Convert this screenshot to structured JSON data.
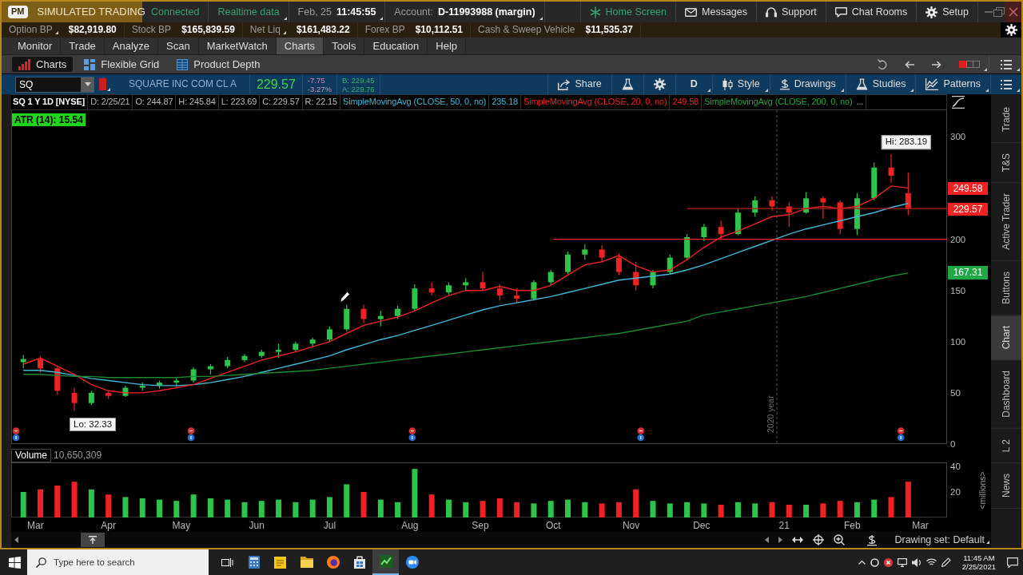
{
  "title_bar": {
    "badge": "PM",
    "mode": "SIMULATED TRADING",
    "status": [
      {
        "label": "Connected",
        "menu": false
      },
      {
        "label": "Realtime data",
        "menu": true
      }
    ],
    "clock": {
      "date": "Feb, 25",
      "time": "11:45:55",
      "menu": true
    },
    "account": {
      "label": "Account:",
      "value": "D-11993988 (margin)",
      "menu": true
    },
    "links": [
      {
        "kind": "home",
        "label": "Home Screen"
      },
      {
        "kind": "mail",
        "label": "Messages"
      },
      {
        "kind": "headset",
        "label": "Support"
      },
      {
        "kind": "chat",
        "label": "Chat Rooms"
      },
      {
        "kind": "gear",
        "label": "Setup"
      }
    ]
  },
  "account_bar": [
    {
      "label": "Option BP",
      "value": "$82,919.80",
      "menu": true
    },
    {
      "label": "Stock BP",
      "value": "$165,839.59",
      "menu": false
    },
    {
      "label": "Net Liq",
      "value": "$161,483.22",
      "menu": true
    },
    {
      "label": "Forex BP",
      "value": "$10,112.51",
      "menu": false
    },
    {
      "label": "Cash & Sweep Vehicle",
      "value": "$11,535.37",
      "menu": false
    }
  ],
  "main_tabs": [
    {
      "label": "Monitor",
      "selected": false
    },
    {
      "label": "Trade",
      "selected": false
    },
    {
      "label": "Analyze",
      "selected": false
    },
    {
      "label": "Scan",
      "selected": false
    },
    {
      "label": "MarketWatch",
      "selected": false
    },
    {
      "label": "Charts",
      "selected": true
    },
    {
      "label": "Tools",
      "selected": false
    },
    {
      "label": "Education",
      "selected": false
    },
    {
      "label": "Help",
      "selected": false
    }
  ],
  "sub_tabs": [
    {
      "kind": "charts",
      "label": "Charts",
      "selected": true
    },
    {
      "kind": "grid",
      "label": "Flexible Grid",
      "selected": false
    },
    {
      "kind": "depth",
      "label": "Product Depth",
      "selected": false
    }
  ],
  "quote_bar": {
    "symbol": "SQ",
    "description": "SQUARE INC COM CL A",
    "last": "229.57",
    "change": "-7.75",
    "change_percent": "-3.27%",
    "bid": "B: 229.45",
    "ask": "A: 229.76",
    "tools": [
      {
        "kind": "share",
        "label": "Share",
        "menu": false
      },
      {
        "kind": "flask",
        "menu": false
      },
      {
        "kind": "gear",
        "menu": false
      },
      {
        "kind": "aggregation",
        "label": "D",
        "menu": true
      },
      {
        "kind": "style",
        "label": "Style",
        "menu": true
      },
      {
        "kind": "drawings",
        "label": "Drawings",
        "menu": true
      },
      {
        "kind": "studies",
        "label": "Studies",
        "menu": true
      },
      {
        "kind": "patterns",
        "label": "Patterns",
        "menu": true
      },
      {
        "kind": "menu",
        "menu": true
      }
    ]
  },
  "chart_header": {
    "title": "SQ 1 Y 1D [NYSE]",
    "fields": [
      "D: 2/25/21",
      "O: 244.87",
      "H: 245.84",
      "L: 223.69",
      "C: 229.57",
      "R: 22.15"
    ],
    "studies": [
      {
        "label": "SimpleMovingAvg (CLOSE, 50, 0, no)",
        "value": "235.18",
        "color": "#3fb8d8"
      },
      {
        "label": "SimpleMovingAvg (CLOSE, 20, 0, no)",
        "value": "249.58",
        "color": "#ee2222"
      },
      {
        "label": "SimpleMovingAvg (CLOSE, 200, 0, no)",
        "color": "#22a63a"
      }
    ],
    "more": "..."
  },
  "price_pane": {
    "indicator": "ATR (14): 15.54",
    "axis_badges": [
      {
        "label": "249.58",
        "color": "#ee2222"
      },
      {
        "label": "229.57",
        "color": "#ee2222"
      },
      {
        "label": "167.31",
        "color": "#1fa845"
      }
    ],
    "chart_data": {
      "type": "candlestick",
      "x": [
        "2020-02-26",
        "2020-03-04",
        "2020-03-11",
        "2020-03-18",
        "2020-03-25",
        "2020-04-01",
        "2020-04-08",
        "2020-04-15",
        "2020-04-22",
        "2020-04-29",
        "2020-05-06",
        "2020-05-13",
        "2020-05-20",
        "2020-05-27",
        "2020-06-03",
        "2020-06-10",
        "2020-06-17",
        "2020-06-24",
        "2020-07-01",
        "2020-07-08",
        "2020-07-15",
        "2020-07-22",
        "2020-07-29",
        "2020-08-05",
        "2020-08-12",
        "2020-08-19",
        "2020-08-26",
        "2020-09-02",
        "2020-09-09",
        "2020-09-16",
        "2020-09-23",
        "2020-09-30",
        "2020-10-07",
        "2020-10-14",
        "2020-10-21",
        "2020-10-28",
        "2020-11-04",
        "2020-11-11",
        "2020-11-18",
        "2020-11-25",
        "2020-12-02",
        "2020-12-09",
        "2020-12-16",
        "2020-12-23",
        "2020-12-30",
        "2021-01-06",
        "2021-01-13",
        "2021-01-20",
        "2021-01-27",
        "2021-02-03",
        "2021-02-10",
        "2021-02-17",
        "2021-02-24"
      ],
      "ohlc": [
        [
          80,
          87,
          74,
          83
        ],
        [
          83,
          86,
          70,
          74
        ],
        [
          74,
          76,
          48,
          52
        ],
        [
          50,
          55,
          32.33,
          40
        ],
        [
          40,
          52,
          38,
          50
        ],
        [
          50,
          52,
          44,
          47
        ],
        [
          47,
          57,
          46,
          55
        ],
        [
          55,
          60,
          52,
          57
        ],
        [
          57,
          62,
          54,
          60
        ],
        [
          60,
          64,
          56,
          62
        ],
        [
          62,
          75,
          60,
          73
        ],
        [
          73,
          78,
          68,
          76
        ],
        [
          76,
          85,
          74,
          82
        ],
        [
          82,
          88,
          80,
          86
        ],
        [
          86,
          92,
          84,
          90
        ],
        [
          90,
          98,
          84,
          92
        ],
        [
          92,
          100,
          90,
          98
        ],
        [
          98,
          104,
          95,
          102
        ],
        [
          102,
          115,
          100,
          112
        ],
        [
          112,
          136,
          110,
          132
        ],
        [
          132,
          136,
          118,
          122
        ],
        [
          122,
          130,
          115,
          125
        ],
        [
          125,
          135,
          122,
          132
        ],
        [
          132,
          156,
          130,
          152
        ],
        [
          152,
          158,
          145,
          148
        ],
        [
          148,
          158,
          146,
          155
        ],
        [
          155,
          162,
          150,
          158
        ],
        [
          158,
          168,
          150,
          152
        ],
        [
          152,
          156,
          140,
          145
        ],
        [
          145,
          152,
          138,
          142
        ],
        [
          142,
          160,
          140,
          158
        ],
        [
          158,
          170,
          155,
          168
        ],
        [
          168,
          188,
          166,
          185
        ],
        [
          185,
          195,
          180,
          190
        ],
        [
          190,
          194,
          178,
          182
        ],
        [
          182,
          186,
          165,
          168
        ],
        [
          168,
          178,
          150,
          155
        ],
        [
          155,
          170,
          152,
          168
        ],
        [
          168,
          185,
          166,
          182
        ],
        [
          182,
          205,
          180,
          202
        ],
        [
          202,
          215,
          198,
          212
        ],
        [
          212,
          218,
          200,
          205
        ],
        [
          205,
          230,
          204,
          226
        ],
        [
          226,
          242,
          222,
          238
        ],
        [
          238,
          242,
          228,
          232
        ],
        [
          232,
          236,
          212,
          226
        ],
        [
          226,
          246,
          225,
          240
        ],
        [
          240,
          242,
          220,
          236
        ],
        [
          236,
          238,
          205,
          210
        ],
        [
          210,
          245,
          204,
          240
        ],
        [
          240,
          275,
          238,
          270
        ],
        [
          270,
          283.19,
          255,
          262
        ],
        [
          245,
          265,
          223.69,
          229.57
        ]
      ],
      "series": [
        {
          "type": "line",
          "color": "#3fb8d8",
          "values": [
            72,
            72,
            70,
            67,
            64,
            62,
            60,
            58,
            57,
            57,
            58,
            60,
            63,
            66,
            70,
            74,
            78,
            82,
            86,
            92,
            97,
            102,
            106,
            111,
            116,
            121,
            126,
            131,
            135,
            138,
            141,
            144,
            148,
            152,
            156,
            160,
            162,
            164,
            166,
            170,
            175,
            181,
            187,
            193,
            199,
            205,
            210,
            214,
            218,
            222,
            226,
            231,
            235
          ]
        },
        {
          "type": "line",
          "color": "#ee2222",
          "values": [
            78,
            84,
            76,
            68,
            58,
            52,
            50,
            50,
            52,
            55,
            58,
            64,
            70,
            76,
            82,
            86,
            90,
            95,
            100,
            108,
            116,
            120,
            124,
            130,
            138,
            145,
            150,
            150,
            154,
            150,
            150,
            155,
            165,
            175,
            178,
            184,
            174,
            168,
            170,
            180,
            192,
            202,
            208,
            215,
            222,
            224,
            230,
            232,
            230,
            232,
            240,
            252,
            250
          ]
        },
        {
          "type": "line",
          "color": "#1a8a30",
          "values": [
            68,
            68,
            67,
            66,
            66,
            65,
            65,
            65,
            65,
            65,
            66,
            66,
            67,
            68,
            69,
            70,
            71,
            72,
            74,
            76,
            78,
            80,
            82,
            84,
            86,
            88,
            90,
            92,
            94,
            96,
            98,
            100,
            102,
            104,
            106,
            108,
            111,
            114,
            117,
            120,
            126,
            129,
            132,
            135,
            138,
            141,
            144,
            148,
            152,
            156,
            160,
            164,
            167
          ]
        },
        {
          "type": "line",
          "color": "#ee2222",
          "x": [
            "2020-10-01",
            "2021-03-12"
          ],
          "values": [
            200,
            200
          ]
        },
        {
          "type": "line",
          "color": "#b52020",
          "x": [
            "2020-11-25",
            "2021-03-12"
          ],
          "values": [
            230,
            230
          ]
        }
      ],
      "xlim": [
        "2020-02-21",
        "2021-03-12"
      ],
      "ylim": [
        0,
        326
      ],
      "yticks": [
        0,
        50,
        100,
        150,
        200,
        300
      ],
      "tick_labels": "y",
      "ref_lines": [
        {
          "axis": "x",
          "value": "2021-01-01",
          "label": "2020 year",
          "color": "#555555",
          "line_style": "dashed"
        }
      ],
      "annotations": [
        "Hi: 283.19",
        "Lo: 32.33"
      ]
    }
  },
  "volume_pane": {
    "reading": "10,650,309",
    "chart_data": {
      "type": "bar",
      "title": "Volume",
      "ylabel": "<millions>",
      "x": [
        "2020-02-26",
        "2020-03-04",
        "2020-03-11",
        "2020-03-18",
        "2020-03-25",
        "2020-04-01",
        "2020-04-08",
        "2020-04-15",
        "2020-04-22",
        "2020-04-29",
        "2020-05-06",
        "2020-05-13",
        "2020-05-20",
        "2020-05-27",
        "2020-06-03",
        "2020-06-10",
        "2020-06-17",
        "2020-06-24",
        "2020-07-01",
        "2020-07-08",
        "2020-07-15",
        "2020-07-22",
        "2020-07-29",
        "2020-08-05",
        "2020-08-12",
        "2020-08-19",
        "2020-08-26",
        "2020-09-02",
        "2020-09-09",
        "2020-09-16",
        "2020-09-23",
        "2020-09-30",
        "2020-10-07",
        "2020-10-14",
        "2020-10-21",
        "2020-10-28",
        "2020-11-04",
        "2020-11-11",
        "2020-11-18",
        "2020-11-25",
        "2020-12-02",
        "2020-12-09",
        "2020-12-16",
        "2020-12-23",
        "2020-12-30",
        "2021-01-06",
        "2021-01-13",
        "2021-01-20",
        "2021-01-27",
        "2021-02-03",
        "2021-02-10",
        "2021-02-17",
        "2021-02-24"
      ],
      "values": [
        20,
        22,
        25,
        28,
        22,
        18,
        16,
        15,
        14,
        13,
        18,
        15,
        14,
        12,
        13,
        14,
        12,
        14,
        16,
        26,
        20,
        14,
        12,
        38,
        18,
        14,
        12,
        13,
        15,
        12,
        11,
        13,
        14,
        12,
        11,
        12,
        22,
        13,
        11,
        12,
        11,
        10,
        12,
        11,
        12,
        10,
        10,
        11,
        13,
        12,
        14,
        16,
        28
      ],
      "colors": [
        "#2ec44a",
        "#ee2222",
        "#ee2222",
        "#ee2222",
        "#2ec44a",
        "#ee2222",
        "#2ec44a",
        "#2ec44a",
        "#2ec44a",
        "#2ec44a",
        "#2ec44a",
        "#2ec44a",
        "#2ec44a",
        "#2ec44a",
        "#2ec44a",
        "#2ec44a",
        "#2ec44a",
        "#2ec44a",
        "#2ec44a",
        "#2ec44a",
        "#ee2222",
        "#2ec44a",
        "#2ec44a",
        "#2ec44a",
        "#ee2222",
        "#2ec44a",
        "#2ec44a",
        "#ee2222",
        "#ee2222",
        "#ee2222",
        "#2ec44a",
        "#2ec44a",
        "#2ec44a",
        "#2ec44a",
        "#ee2222",
        "#ee2222",
        "#ee2222",
        "#2ec44a",
        "#2ec44a",
        "#2ec44a",
        "#2ec44a",
        "#ee2222",
        "#2ec44a",
        "#2ec44a",
        "#ee2222",
        "#ee2222",
        "#2ec44a",
        "#ee2222",
        "#ee2222",
        "#2ec44a",
        "#2ec44a",
        "#ee2222",
        "#ee2222"
      ],
      "xlim": [
        "2020-02-21",
        "2021-03-12"
      ],
      "ylim": [
        0,
        42.5
      ],
      "yticks": [
        20,
        40
      ],
      "xticks": [
        {
          "value": "2020-03-02",
          "label": "Mar"
        },
        {
          "value": "2020-04-01",
          "label": "Apr"
        },
        {
          "value": "2020-05-01",
          "label": "May"
        },
        {
          "value": "2020-06-01",
          "label": "Jun"
        },
        {
          "value": "2020-07-01",
          "label": "Jul"
        },
        {
          "value": "2020-08-03",
          "label": "Aug"
        },
        {
          "value": "2020-09-01",
          "label": "Sep"
        },
        {
          "value": "2020-10-01",
          "label": "Oct"
        },
        {
          "value": "2020-11-02",
          "label": "Nov"
        },
        {
          "value": "2020-12-01",
          "label": "Dec"
        },
        {
          "value": "2021-01-04",
          "label": "21"
        },
        {
          "value": "2021-02-01",
          "label": "Feb"
        },
        {
          "value": "2021-03-01",
          "label": "Mar"
        }
      ]
    }
  },
  "bottom_bar": {
    "drawing_set": "Drawing set: Default"
  },
  "side_tabs": [
    {
      "label": "Trade",
      "selected": false
    },
    {
      "label": "T&S",
      "selected": false
    },
    {
      "label": "Active Trader",
      "selected": false
    },
    {
      "label": "Buttons",
      "selected": false
    },
    {
      "label": "Chart",
      "selected": true
    },
    {
      "label": "Dashboard",
      "selected": false
    },
    {
      "label": "L 2",
      "selected": false
    },
    {
      "label": "News",
      "selected": false
    }
  ],
  "taskbar": {
    "search_placeholder": "Type here to search",
    "apps": [
      {
        "kind": "task_view",
        "selected": false
      },
      {
        "kind": "calculator",
        "selected": false
      },
      {
        "kind": "notes",
        "selected": false
      },
      {
        "kind": "folder",
        "selected": false
      },
      {
        "kind": "browser",
        "selected": false
      },
      {
        "kind": "store",
        "selected": false
      },
      {
        "kind": "trading",
        "selected": true
      },
      {
        "kind": "meeting",
        "selected": false
      }
    ],
    "time": "11:45 AM",
    "date": "2/25/2021"
  }
}
